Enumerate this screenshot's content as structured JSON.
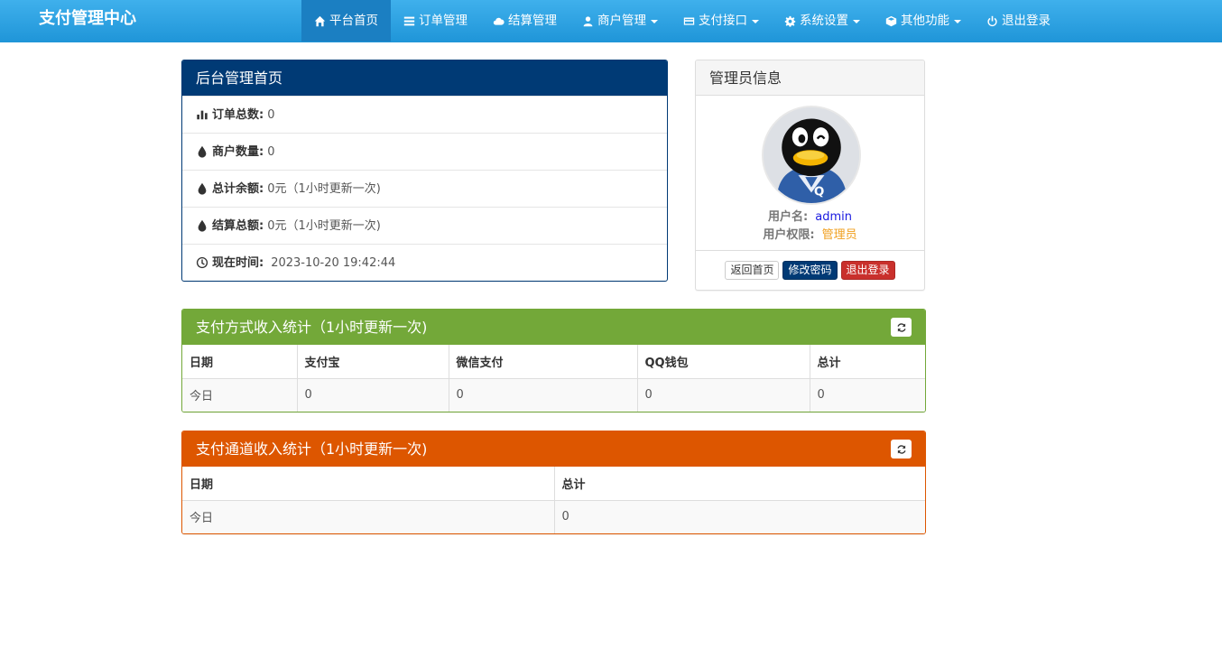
{
  "brand": "支付管理中心",
  "nav": {
    "items": [
      {
        "label": "平台首页",
        "icon": "home-icon",
        "dropdown": false,
        "active": true
      },
      {
        "label": "订单管理",
        "icon": "list-icon",
        "dropdown": false,
        "active": false
      },
      {
        "label": "结算管理",
        "icon": "cloud-icon",
        "dropdown": false,
        "active": false
      },
      {
        "label": "商户管理",
        "icon": "user-icon",
        "dropdown": true,
        "active": false
      },
      {
        "label": "支付接口",
        "icon": "credit-card-icon",
        "dropdown": true,
        "active": false
      },
      {
        "label": "系统设置",
        "icon": "gear-icon",
        "dropdown": true,
        "active": false
      },
      {
        "label": "其他功能",
        "icon": "cube-icon",
        "dropdown": true,
        "active": false
      },
      {
        "label": "退出登录",
        "icon": "power-icon",
        "dropdown": false,
        "active": false
      }
    ]
  },
  "admin_panel": {
    "title": "后台管理首页",
    "rows": [
      {
        "label": "订单总数:",
        "value": "0",
        "icon": "bar-chart-icon"
      },
      {
        "label": "商户数量:",
        "value": "0",
        "icon": "drop-icon"
      },
      {
        "label": "总计余额:",
        "value": "0元（1小时更新一次)",
        "icon": "drop-icon"
      },
      {
        "label": "结算总额:",
        "value": "0元（1小时更新一次)",
        "icon": "drop-icon"
      },
      {
        "label": "现在时间:",
        "value": "2023-10-20 19:42:44",
        "icon": "clock-icon"
      }
    ]
  },
  "user_panel": {
    "title": "管理员信息",
    "username_label": "用户名:",
    "username": "admin",
    "role_label": "用户权限:",
    "role": "管理员",
    "buttons": {
      "home": "返回首页",
      "change_password": "修改密码",
      "logout": "退出登录"
    }
  },
  "pay_stats": {
    "title": "支付方式收入统计（1小时更新一次)",
    "headers": [
      "日期",
      "支付宝",
      "微信支付",
      "QQ钱包",
      "总计"
    ],
    "rows": [
      [
        "今日",
        "0",
        "0",
        "0",
        "0"
      ]
    ]
  },
  "channel_stats": {
    "title": "支付通道收入统计（1小时更新一次)",
    "headers": [
      "日期",
      "总计"
    ],
    "rows": [
      [
        "今日",
        "0"
      ]
    ]
  },
  "colors": {
    "navbar": "#2aa2e2",
    "admin_panel": "#003a75",
    "pay_panel": "#73a839",
    "channel_panel": "#dd5600"
  }
}
